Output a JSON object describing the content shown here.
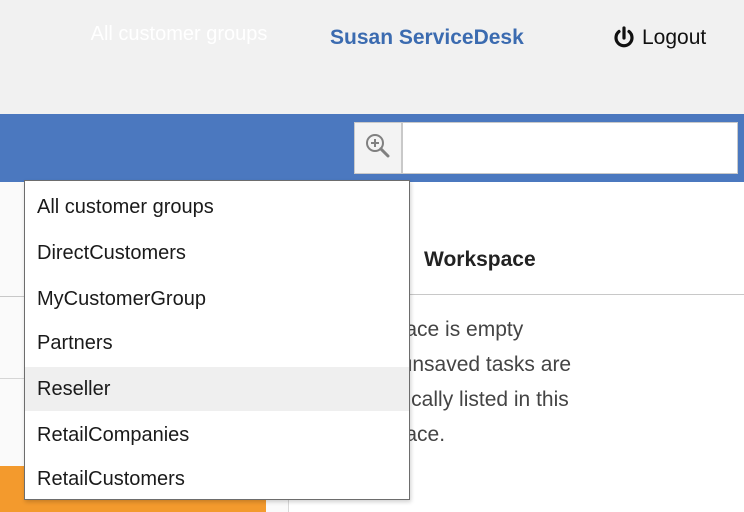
{
  "header": {
    "user_name": "Susan ServiceDesk",
    "logout_label": "Logout",
    "logout_icon": "power-icon"
  },
  "toolbar": {
    "selected_group": "All customer groups",
    "search_icon": "zoom-in-icon",
    "search_value": ""
  },
  "dropdown": {
    "items": [
      "All customer groups",
      "DirectCustomers",
      "MyCustomerGroup",
      "Partners",
      "Reseller",
      "RetailCompanies",
      "RetailCustomers"
    ],
    "highlighted": "Reseller"
  },
  "workspace": {
    "title": "Workspace",
    "empty_lines": [
      "orkspace is empty",
      "your unsaved tasks are",
      "tomatically listed in this",
      "orkspace."
    ]
  },
  "colors": {
    "brand_blue": "#4b78bf",
    "user_name": "#3b6bb0",
    "accent_orange": "#f39a2d",
    "header_bg": "#f1f1f1"
  }
}
